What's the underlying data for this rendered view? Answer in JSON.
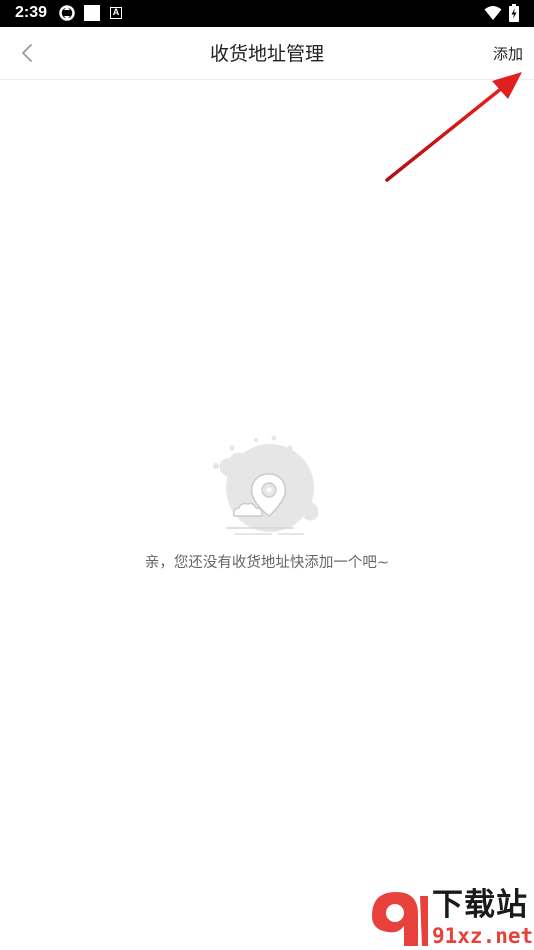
{
  "status_bar": {
    "time": "2:39",
    "icon_a_label": "A"
  },
  "nav": {
    "title": "收货地址管理",
    "add_label": "添加"
  },
  "empty_state": {
    "message": "亲，您还没有收货地址快添加一个吧~"
  },
  "watermark": {
    "title": "下载站",
    "domain": "91xz.net"
  },
  "colors": {
    "status_bar_bg": "#000000",
    "arrow": "#e02020",
    "watermark_red": "#e8413c",
    "placeholder_gray": "#e3e3e3"
  }
}
